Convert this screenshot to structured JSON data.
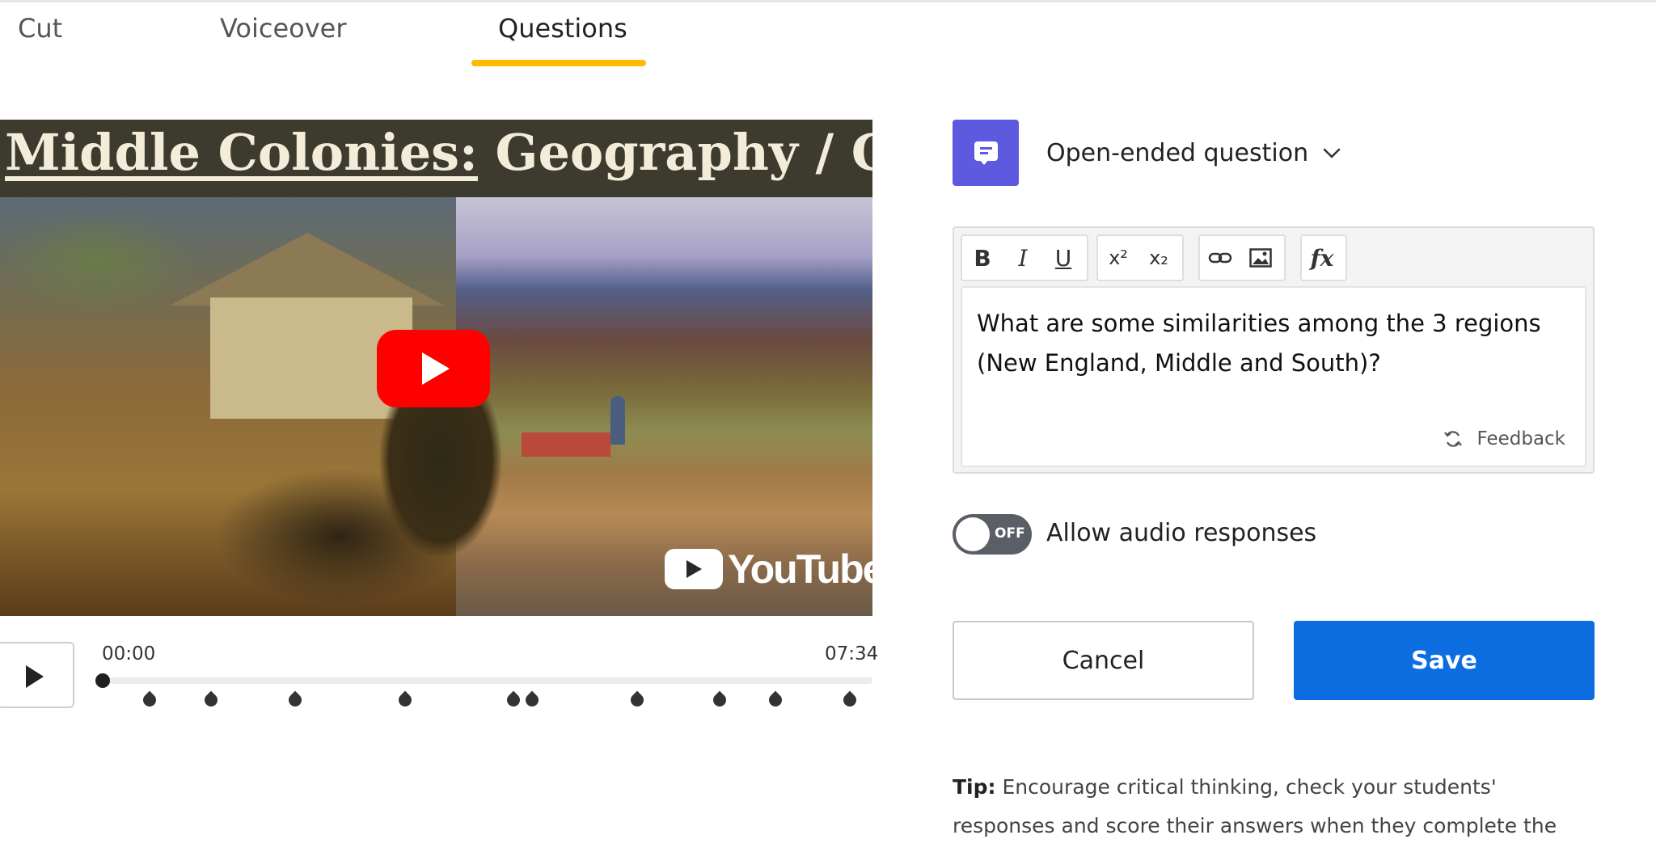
{
  "tabs": [
    {
      "label": "Cut",
      "active": false
    },
    {
      "label": "Voiceover",
      "active": false
    },
    {
      "label": "Questions",
      "active": true
    }
  ],
  "video": {
    "title_underlined": "Middle Colonies:",
    "title_rest": " Geography / Clir",
    "provider": "YouTube",
    "time_start": "00:00",
    "time_end": "07:34",
    "progress": 0
  },
  "question": {
    "type_label": "Open-ended question",
    "text": "What are some similarities among the 3 regions (New England, Middle and South)?",
    "feedback_label": "Feedback"
  },
  "toolbar": {
    "bold": "B",
    "italic": "I",
    "underline": "U",
    "superscript": "x²",
    "subscript": "x₂",
    "formula": "fx"
  },
  "audio": {
    "toggle_state": "OFF",
    "label": "Allow audio responses"
  },
  "actions": {
    "cancel": "Cancel",
    "save": "Save"
  },
  "tip": {
    "prefix": "Tip:",
    "text": " Encourage critical thinking, check your students' responses and score their answers when they complete the video."
  },
  "colors": {
    "accent_tab": "#ffbb00",
    "save_blue": "#0b6de0",
    "question_icon": "#5e5ae0",
    "youtube_red": "#ff0000"
  }
}
